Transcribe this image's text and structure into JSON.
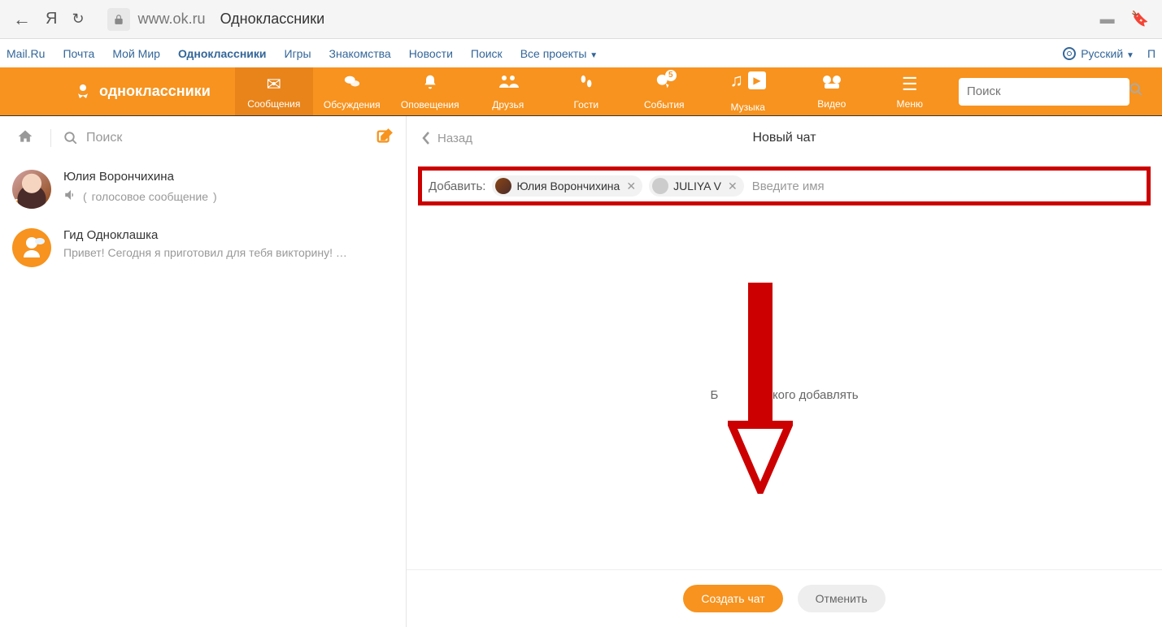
{
  "browser": {
    "url_domain": "www.ok.ru",
    "url_title": "Одноклассники"
  },
  "portal": {
    "links": [
      "Mail.Ru",
      "Почта",
      "Мой Мир",
      "Одноклассники",
      "Игры",
      "Знакомства",
      "Новости",
      "Поиск",
      "Все проекты"
    ],
    "active_index": 3,
    "language": "Русский",
    "initial": "П"
  },
  "nav": {
    "brand": "одноклассники",
    "items": [
      {
        "label": "Сообщения"
      },
      {
        "label": "Обсуждения"
      },
      {
        "label": "Оповещения"
      },
      {
        "label": "Друзья"
      },
      {
        "label": "Гости"
      },
      {
        "label": "События",
        "badge": "5"
      },
      {
        "label": "Музыка"
      },
      {
        "label": "Видео"
      },
      {
        "label": "Меню"
      }
    ],
    "active_index": 0,
    "search_placeholder": "Поиск"
  },
  "sidebar": {
    "search_placeholder": "Поиск",
    "chats": [
      {
        "name": "Юлия Ворончихина",
        "preview_type": "voice",
        "preview": "голосовое сообщение"
      },
      {
        "name": "Гид Одноклашка",
        "preview": "Привет! Сегодня я приготовил для тебя викторину! …"
      }
    ]
  },
  "content": {
    "back_label": "Назад",
    "title": "Новый чат",
    "add_label": "Добавить:",
    "chips": [
      {
        "name": "Юлия Ворончихина"
      },
      {
        "name": "JULIYA V"
      }
    ],
    "input_placeholder": "Введите имя",
    "empty_text_left": "Б",
    "empty_text_right": "некого добавлять",
    "create_btn": "Создать чат",
    "cancel_btn": "Отменить"
  }
}
